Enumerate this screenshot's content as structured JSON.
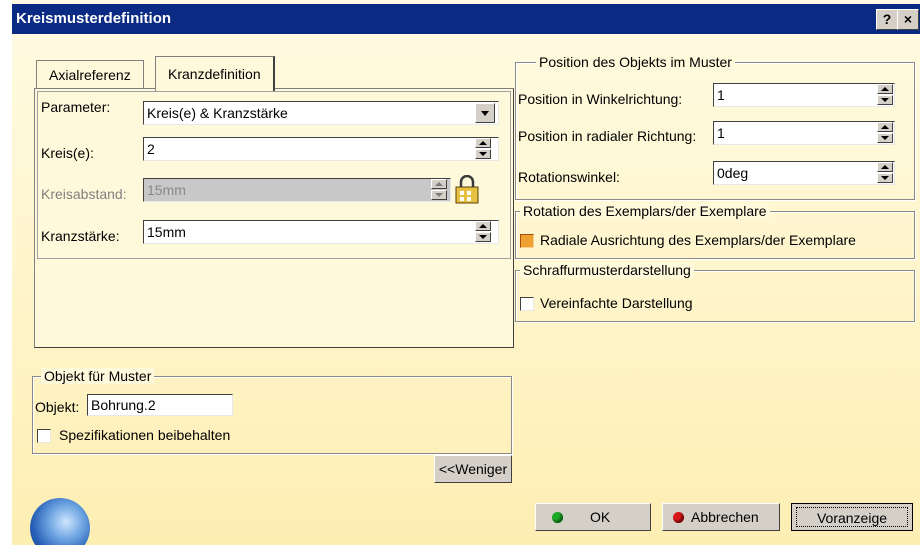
{
  "window": {
    "title": "Kreismusterdefinition",
    "help_label": "?",
    "close_label": "×"
  },
  "tabs": [
    {
      "label": "Axialreferenz",
      "active": false
    },
    {
      "label": "Kranzdefinition",
      "active": true
    }
  ],
  "kranz": {
    "parameter_label": "Parameter:",
    "parameter_value": "Kreis(e) & Kranzstärke",
    "kreise_label": "Kreis(e):",
    "kreise_value": "2",
    "kreisabstand_label": "Kreisabstand:",
    "kreisabstand_value": "15mm",
    "kranzstaerke_label": "Kranzstärke:",
    "kranzstaerke_value": "15mm"
  },
  "objekt_group": {
    "legend": "Objekt für Muster",
    "objekt_label": "Objekt:",
    "objekt_value": "Bohrung.2",
    "spec_label": "Spezifikationen beibehalten",
    "spec_checked": false
  },
  "less_button": "<<Weniger",
  "position_group": {
    "legend": "Position des Objekts im Muster",
    "winkel_label": "Position in Winkelrichtung:",
    "winkel_value": "1",
    "radial_label": "Position in radialer Richtung:",
    "radial_value": "1",
    "rotation_label": "Rotationswinkel:",
    "rotation_value": "0deg"
  },
  "rotation_group": {
    "legend": "Rotation des Exemplars/der Exemplare",
    "radial_label": "Radiale Ausrichtung des Exemplars/der Exemplare",
    "radial_checked": true
  },
  "schraffur_group": {
    "legend": "Schraffurmusterdarstellung",
    "simple_label": "Vereinfachte Darstellung",
    "simple_checked": false
  },
  "buttons": {
    "ok": "OK",
    "cancel": "Abbrechen",
    "preview": "Voranzeige"
  },
  "colors": {
    "titlebar": "#0b2a84",
    "ok_dot": "#1faa2a",
    "cancel_dot": "#d81818",
    "checkbox_on": "#f0a030"
  }
}
